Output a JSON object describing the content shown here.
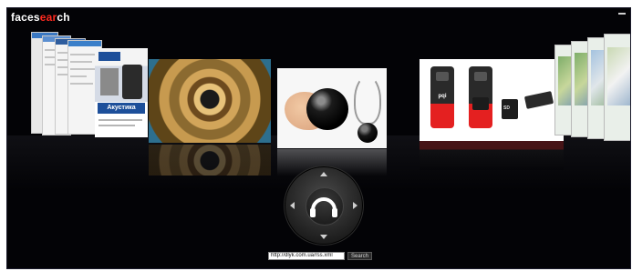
{
  "app": {
    "logo_part1": "faces",
    "logo_part2": "ear",
    "logo_part3": "ch"
  },
  "search": {
    "url_value": "http://dlyk.com.ua/rss.xml",
    "button_label": "Search"
  },
  "covers": {
    "magazine_title": "Акустика",
    "reader_brand": "pqi"
  },
  "colors": {
    "background": "#030306",
    "logo_accent": "#ff2a1f",
    "reader_red": "#e42020"
  },
  "icons": {
    "controller_center": "headphones-icon",
    "nav_up": "arrow-up-icon",
    "nav_down": "arrow-down-icon",
    "nav_left": "arrow-left-icon",
    "nav_right": "arrow-right-icon"
  }
}
